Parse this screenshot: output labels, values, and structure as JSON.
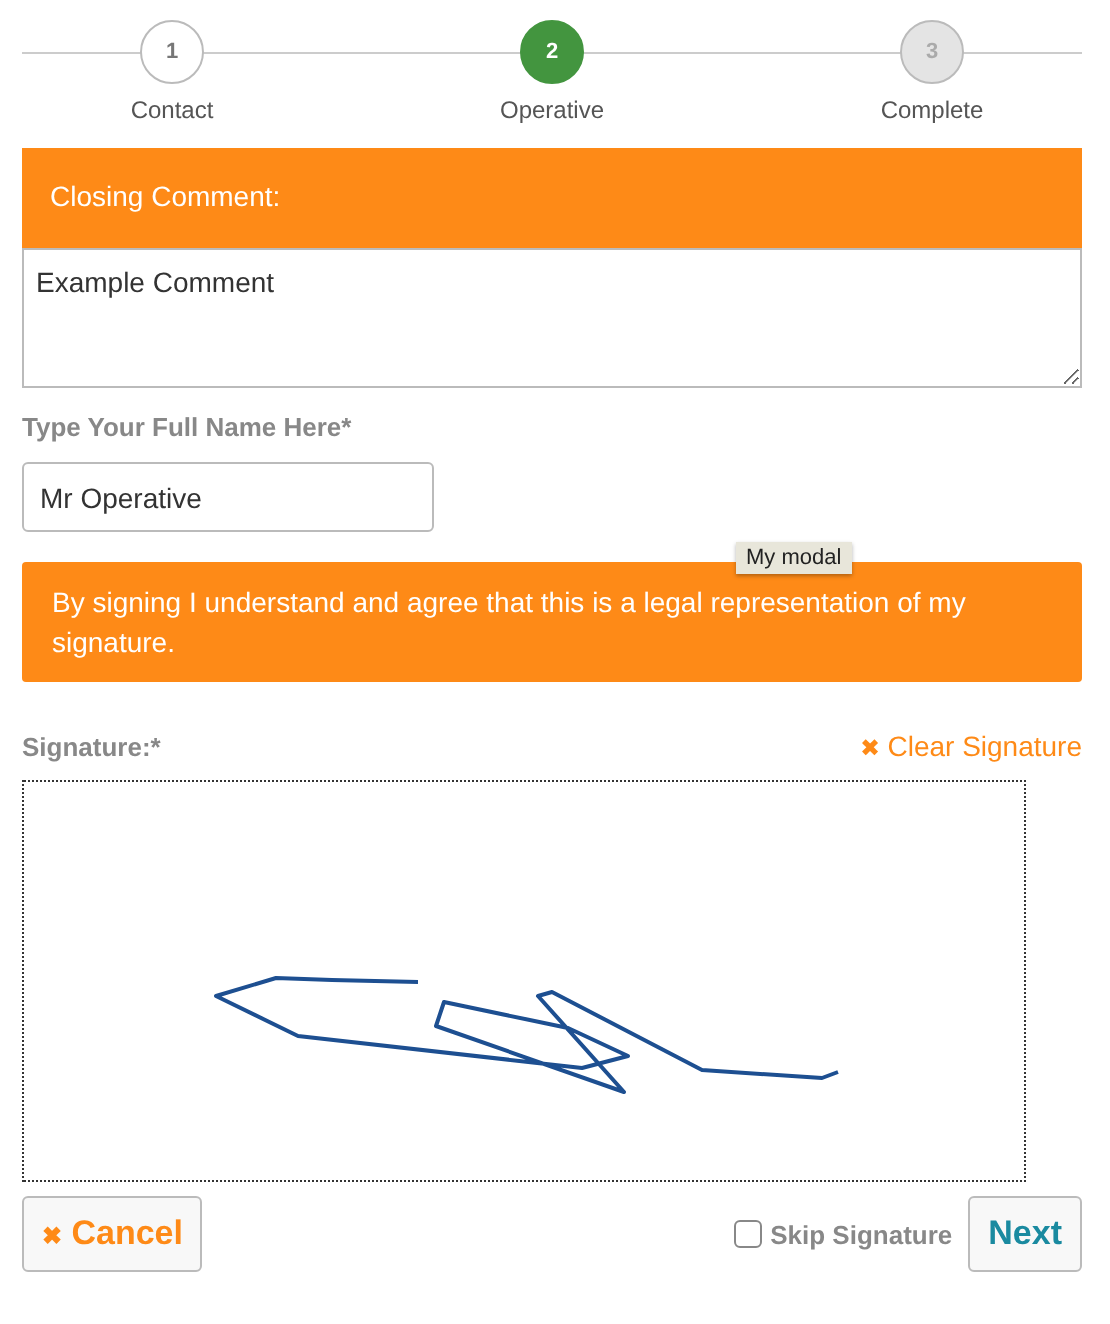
{
  "steps": [
    {
      "number": "1",
      "label": "Contact",
      "kind": "done"
    },
    {
      "number": "2",
      "label": "Operative",
      "kind": "active"
    },
    {
      "number": "3",
      "label": "Complete",
      "kind": "pending"
    }
  ],
  "comment": {
    "heading": "Closing Comment:",
    "value": "Example Comment"
  },
  "name_field": {
    "label": "Type Your Full Name Here*",
    "value": "Mr Operative"
  },
  "notice": "By signing I understand and agree that this is a legal representation of my signature.",
  "tooltip": "My modal",
  "signature": {
    "label": "Signature:*",
    "clear_icon": "✖",
    "clear": "Clear Signature"
  },
  "footer": {
    "cancel_icon": "✖",
    "cancel": "Cancel",
    "skip": {
      "label": "Skip Signature",
      "checked": false
    },
    "next": "Next"
  }
}
